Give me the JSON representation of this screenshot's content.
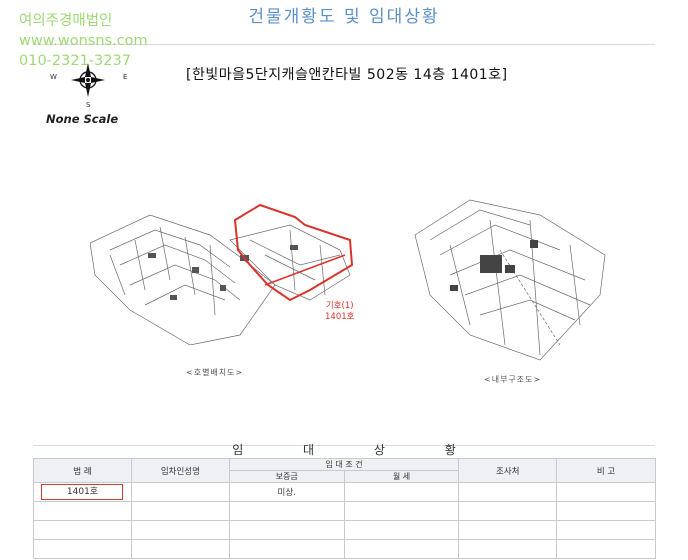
{
  "header": {
    "title": "건물개황도 및 임대상황"
  },
  "watermark": {
    "line1": "여의주경매법인",
    "line2": "www.wonsns.com",
    "line3": "010-2321-3237"
  },
  "compass": {
    "n": "N",
    "s": "S",
    "w": "W",
    "e": "E"
  },
  "scale_note": "None Scale",
  "plan": {
    "title": "[한빛마을5단지캐슬앤칸타빌 502동 14층 1401호]",
    "left_caption": "<호별배치도>",
    "right_caption": "<내부구조도>",
    "unit_label_line1": "기호(1)",
    "unit_label_line2": "1401호",
    "highlight_color": "#d9342b"
  },
  "lease": {
    "section_title": "임 대 상 황",
    "headers": {
      "room": "범 례",
      "tenant": "임차인성명",
      "terms": "임 대 조 건",
      "deposit": "보증금",
      "rent": "월 세",
      "surveyor": "조사처",
      "remarks": "비 고"
    },
    "rows": [
      {
        "room": "1401호",
        "tenant": "",
        "deposit": "미상.",
        "rent": "",
        "surveyor": "",
        "remarks": ""
      }
    ]
  }
}
